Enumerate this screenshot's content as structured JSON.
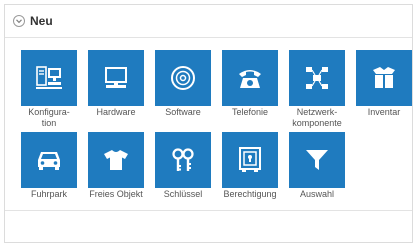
{
  "panel": {
    "title": "Neu",
    "collapse_icon": "chevron-down-circle-icon"
  },
  "colors": {
    "tile_background": "#1f7bbf",
    "tile_icon": "#ffffff",
    "label_text": "#555555"
  },
  "tiles": [
    {
      "label": "Konfigura-\ntion",
      "icon": "computer-workstation-icon"
    },
    {
      "label": "Hardware",
      "icon": "monitor-icon"
    },
    {
      "label": "Software",
      "icon": "disc-icon"
    },
    {
      "label": "Telefonie",
      "icon": "telephone-icon"
    },
    {
      "label": "Netzwerk-\nkomponente",
      "icon": "network-icon"
    },
    {
      "label": "Inventar",
      "icon": "box-icon"
    },
    {
      "label": "Fuhrpark",
      "icon": "car-icon"
    },
    {
      "label": "Freies Objekt",
      "icon": "tshirt-icon"
    },
    {
      "label": "Schlüssel",
      "icon": "keys-icon"
    },
    {
      "label": "Berechtigung",
      "icon": "safe-icon"
    },
    {
      "label": "Auswahl",
      "icon": "funnel-icon"
    }
  ]
}
